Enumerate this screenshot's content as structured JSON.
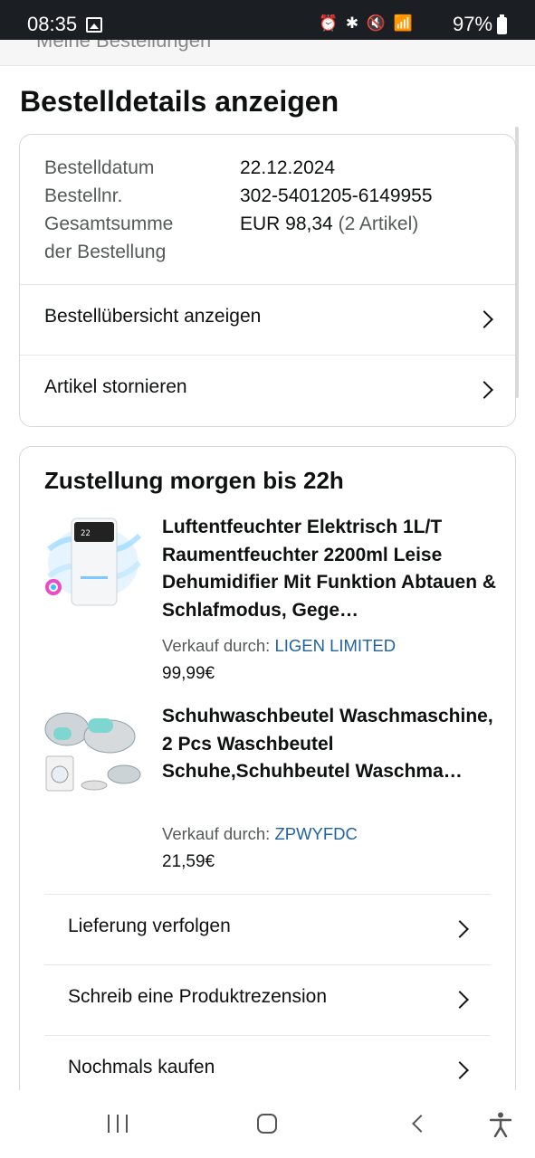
{
  "status_bar": {
    "time": "08:35",
    "icons": "⏰ ✱ 🔇 📶",
    "battery": "97%"
  },
  "top_strip": {
    "text": "Meine Bestellungen"
  },
  "page": {
    "title": "Bestelldetails anzeigen"
  },
  "order_summary": {
    "date_label": "Bestelldatum",
    "date_value": "22.12.2024",
    "number_label": "Bestellnr.",
    "number_value": "302-5401205-6149955",
    "total_label_line1": "Gesamtsumme",
    "total_label_line2": "der Bestellung",
    "total_value": "EUR 98,34",
    "total_items": "(2 Artikel)",
    "links": [
      {
        "label": "Bestellübersicht anzeigen"
      },
      {
        "label": "Artikel stornieren"
      }
    ]
  },
  "shipment": {
    "title": "Zustellung morgen bis 22h",
    "items": [
      {
        "title": "Luftentfeuchter Elektrisch 1L/T Raumentfeuchter 2200ml Leise Dehumidifier Mit Funktion Abtauen & Schlafmodus, Gege…",
        "sold_by_label": "Verkauf durch:",
        "seller": "LIGEN LIMITED",
        "price": "99,99€"
      },
      {
        "title": "Schuhwaschbeutel Waschmaschine, 2 Pcs Waschbeutel Schuhe,Schuhbeutel Waschma…",
        "sold_by_label": "Verkauf durch:",
        "seller": "ZPWYFDC",
        "price": "21,59€"
      }
    ],
    "actions": [
      {
        "label": "Lieferung verfolgen"
      },
      {
        "label": "Schreib eine Produktrezension"
      },
      {
        "label": "Nochmals kaufen"
      }
    ]
  },
  "colors": {
    "seller_link": "#2162a1",
    "status_bar_bg": "#1b1f24",
    "card_border": "#d5d9d9"
  }
}
